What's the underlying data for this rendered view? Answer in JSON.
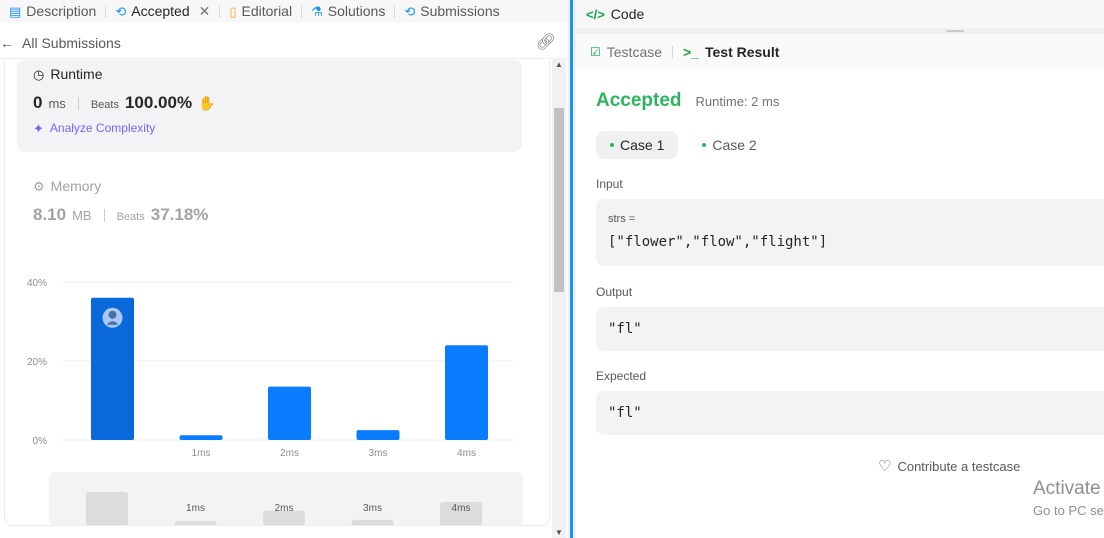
{
  "tabs": [
    {
      "label": "Description",
      "icon": "document-icon"
    },
    {
      "label": "Accepted",
      "icon": "history-icon",
      "active": true
    },
    {
      "label": "Editorial",
      "icon": "book-icon"
    },
    {
      "label": "Solutions",
      "icon": "flask-icon"
    },
    {
      "label": "Submissions",
      "icon": "history-icon"
    }
  ],
  "subbar": {
    "back_label": "All Submissions"
  },
  "runtime": {
    "heading": "Runtime",
    "value": "0",
    "unit": "ms",
    "beats_label": "Beats",
    "beats_value": "100.00%",
    "analyze_label": "Analyze Complexity"
  },
  "memory": {
    "heading": "Memory",
    "value": "8.10",
    "unit": "MB",
    "beats_label": "Beats",
    "beats_value": "37.18%"
  },
  "chart_data": {
    "type": "bar",
    "categories": [
      "0ms",
      "1ms",
      "2ms",
      "3ms",
      "4ms"
    ],
    "tick_labels": [
      "",
      "1ms",
      "2ms",
      "3ms",
      "4ms"
    ],
    "values": [
      36,
      1.2,
      13.5,
      2.5,
      24
    ],
    "highlight_index": 0,
    "y_ticks": [
      "0%",
      "20%",
      "40%"
    ],
    "ylim": [
      0,
      40
    ],
    "grid": true,
    "colors": {
      "bar": "#0a7cff",
      "highlight": "#0969da"
    },
    "minimap_labels": [
      "",
      "1ms",
      "2ms",
      "3ms",
      "4ms"
    ]
  },
  "right": {
    "code_title": "Code",
    "tab_testcase": "Testcase",
    "tab_result": "Test Result",
    "status": "Accepted",
    "runtime_text": "Runtime: 2 ms",
    "cases": [
      "Case 1",
      "Case 2"
    ],
    "input_label": "Input",
    "input_var": "strs =",
    "input_value": "[\"flower\",\"flow\",\"flight\"]",
    "output_label": "Output",
    "output_value": "\"fl\"",
    "expected_label": "Expected",
    "expected_value": "\"fl\"",
    "contribute": "Contribute a testcase"
  },
  "watermark": {
    "line1": "Activate",
    "line2": "Go to PC se"
  },
  "colors": {
    "accent_green": "#2db55d",
    "divider_blue": "#1a90ff",
    "purple": "#7b61ff"
  }
}
